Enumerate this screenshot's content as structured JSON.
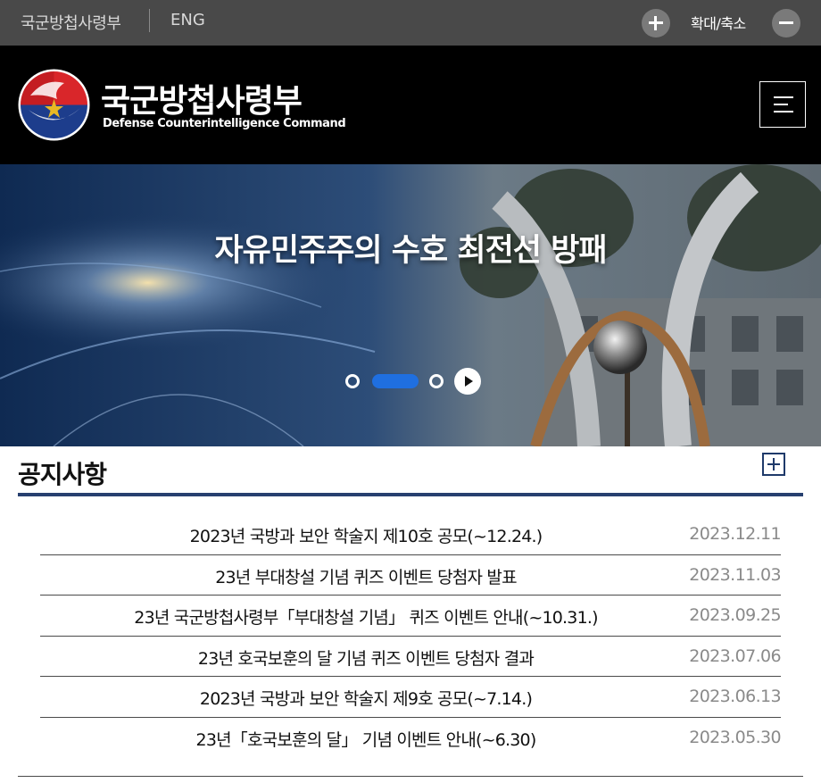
{
  "topbar": {
    "home_label": "국군방첩사령부",
    "eng_label": "ENG",
    "zoom_label": "확대/축소",
    "zoom_in_icon": "plus-icon",
    "zoom_out_icon": "minus-icon"
  },
  "header": {
    "logo_ko": "국군방첩사령부",
    "logo_en": "Defense Counterintelligence Command",
    "menu_icon": "hamburger-menu-icon",
    "background": "#000000"
  },
  "hero": {
    "title": "자유민주주의 수호 최전선 방패",
    "slides_total": 3,
    "active_slide": 2,
    "accent": "#1f6fe0",
    "play_icon": "play-icon"
  },
  "notices": {
    "title": "공지사항",
    "more_icon": "plus-square-icon",
    "accent": "#27406f",
    "items": [
      {
        "title": "2023년 국방과 보안 학술지 제10호 공모(~12.24.)",
        "date": "2023.12.11"
      },
      {
        "title": "23년 부대창설 기념 퀴즈 이벤트 당첨자 발표",
        "date": "2023.11.03"
      },
      {
        "title": "23년 국군방첩사령부「부대창설 기념」 퀴즈 이벤트 안내(~10.31.)",
        "date": "2023.09.25"
      },
      {
        "title": "23년 호국보훈의 달 기념 퀴즈 이벤트 당첨자 결과",
        "date": "2023.07.06"
      },
      {
        "title": "2023년 국방과 보안 학술지 제9호 공모(~7.14.)",
        "date": "2023.06.13"
      },
      {
        "title": "23년「호국보훈의 달」 기념 이벤트 안내(~6.30)",
        "date": "2023.05.30"
      }
    ]
  }
}
